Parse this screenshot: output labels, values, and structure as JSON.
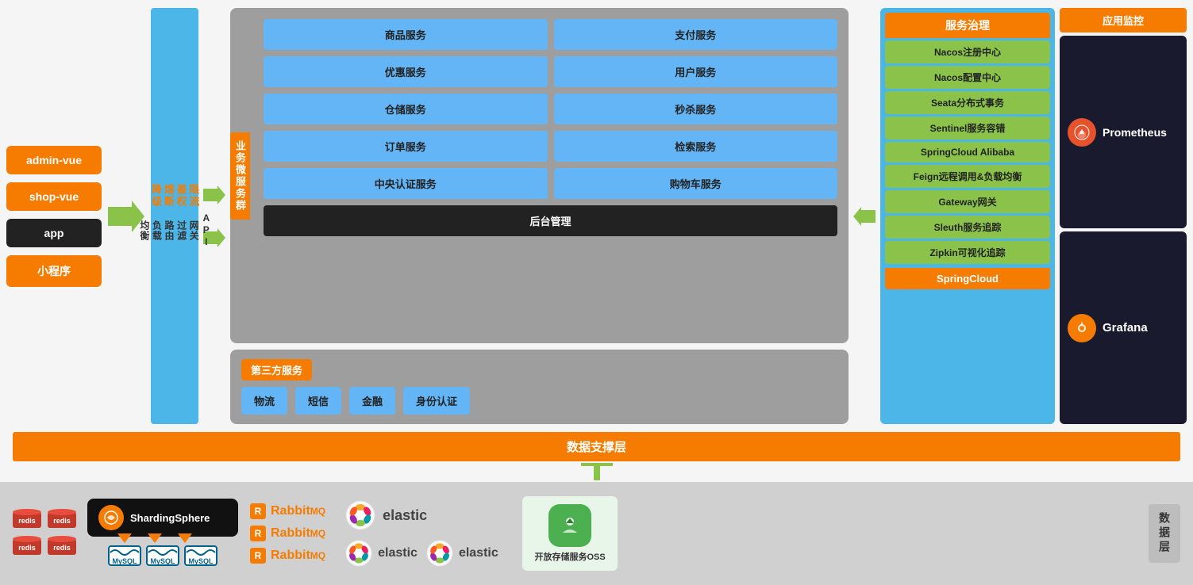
{
  "clients": {
    "items": [
      {
        "label": "admin-vue",
        "style": "orange"
      },
      {
        "label": "shop-vue",
        "style": "orange"
      },
      {
        "label": "app",
        "style": "black"
      },
      {
        "label": "小程序",
        "style": "orange"
      }
    ]
  },
  "gateway": {
    "top_labels": [
      "限流",
      "鉴权",
      "熔断",
      "降级"
    ],
    "bottom_text": "API 网关过滤路由负载均衡",
    "label": "API网关过滤路由负载均衡"
  },
  "business": {
    "section_label": "业务微服务群",
    "services": [
      {
        "label": "商品服务"
      },
      {
        "label": "支付服务"
      },
      {
        "label": "优惠服务"
      },
      {
        "label": "用户服务"
      },
      {
        "label": "仓储服务"
      },
      {
        "label": "秒杀服务"
      },
      {
        "label": "订单服务"
      },
      {
        "label": "检索服务"
      },
      {
        "label": "中央认证服务"
      },
      {
        "label": "购物车服务"
      },
      {
        "label": "后台管理",
        "style": "black",
        "full": true
      }
    ]
  },
  "third_party": {
    "label": "第三方服务",
    "items": [
      {
        "label": "物流"
      },
      {
        "label": "短信"
      },
      {
        "label": "金融"
      },
      {
        "label": "身份认证"
      }
    ]
  },
  "governance": {
    "title": "服务治理",
    "items": [
      {
        "label": "Nacos注册中心"
      },
      {
        "label": "Nacos配置中心"
      },
      {
        "label": "Seata分布式事务"
      },
      {
        "label": "Sentinel服务容错"
      },
      {
        "label": "SpringCloud Alibaba"
      },
      {
        "label": "Feign远程调用&负载均衡"
      },
      {
        "label": "Gateway网关"
      },
      {
        "label": "Sleuth服务追踪"
      },
      {
        "label": "Zipkin可视化追踪"
      }
    ],
    "bottom": "SpringCloud"
  },
  "monitoring": {
    "title": "应用监控",
    "prometheus": {
      "name": "Prometheus",
      "icon": "●"
    },
    "grafana": {
      "name": "Grafana",
      "icon": "◈"
    }
  },
  "data_support": {
    "label": "数据支撑层"
  },
  "data_layer": {
    "label": "数据层",
    "redis": {
      "instances": [
        "redis",
        "redis",
        "redis",
        "redis"
      ]
    },
    "sharding": {
      "name": "ShardingSphere",
      "mysql_count": 3,
      "mysql_label": "MySQL"
    },
    "rabbitmq": {
      "instances": [
        "RabbitMQ",
        "RabbitMQ",
        "RabbitMQ"
      ]
    },
    "elastic": {
      "instances": [
        "elastic",
        "elastic",
        "elastic"
      ]
    },
    "oss": {
      "label": "开放存储服务OSS"
    }
  }
}
